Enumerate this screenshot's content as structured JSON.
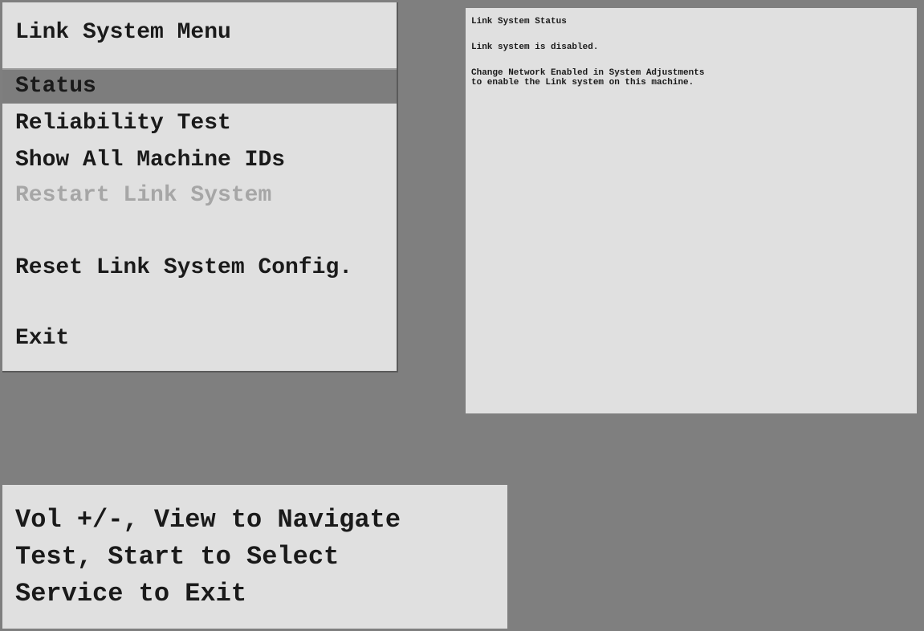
{
  "menu": {
    "title": "Link System Menu",
    "items": [
      {
        "label": "Status",
        "state": "selected"
      },
      {
        "label": "Reliability Test",
        "state": "normal"
      },
      {
        "label": "Show All Machine IDs",
        "state": "normal"
      },
      {
        "label": "Restart Link System",
        "state": "disabled"
      },
      {
        "label": "Reset Link System Config.",
        "state": "normal"
      },
      {
        "label": "Exit",
        "state": "normal"
      }
    ]
  },
  "status_panel": {
    "title": "Link System Status",
    "message": "Link system is disabled.",
    "instructions": [
      "Change Network Enabled in System Adjustments",
      "to enable the Link system on this machine."
    ]
  },
  "help": {
    "lines": [
      "Vol +/-, View to Navigate",
      "Test, Start to Select",
      "Service to Exit"
    ]
  },
  "colors": {
    "background": "#7f7f7f",
    "panel": "#e0e0e0",
    "selected_row": "#7d7d7d",
    "text": "#1a1a1a",
    "disabled_text": "#a6a6a6"
  }
}
